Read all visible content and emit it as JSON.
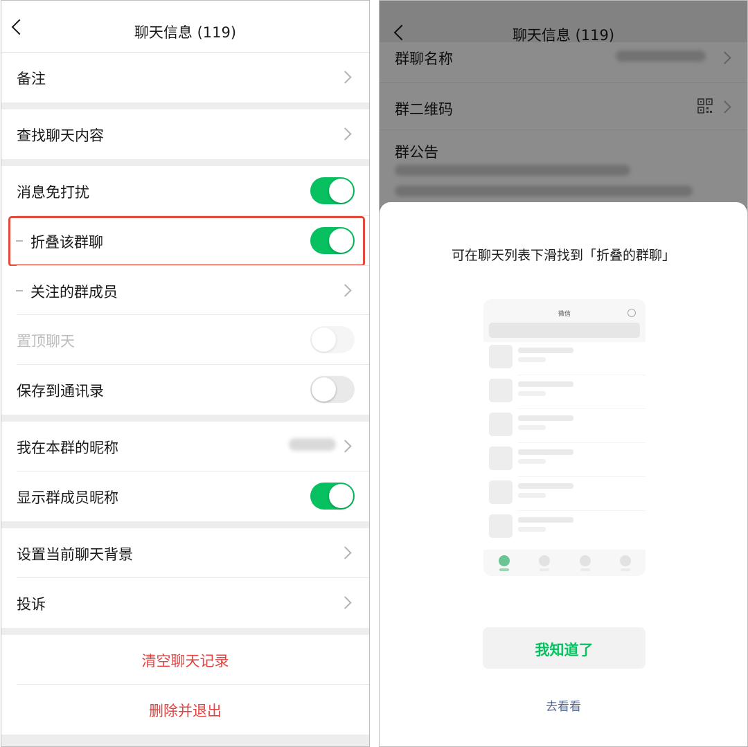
{
  "left": {
    "nav": {
      "title": "聊天信息 (119)"
    },
    "rows": {
      "remark": "备注",
      "search_chat": "查找聊天内容",
      "mute": "消息免打扰",
      "fold_group": "折叠该群聊",
      "follow_members": "关注的群成员",
      "sticky": "置顶聊天",
      "save_contacts": "保存到通讯录",
      "my_nickname": "我在本群的昵称",
      "show_nicknames": "显示群成员昵称",
      "set_background": "设置当前聊天背景",
      "complain": "投诉"
    },
    "toggles": {
      "mute": true,
      "fold_group": true,
      "sticky": false,
      "save_contacts": false,
      "show_nicknames": true
    },
    "actions": {
      "clear_history": "清空聊天记录",
      "delete_exit": "删除并退出"
    }
  },
  "right": {
    "nav": {
      "title": "聊天信息 (119)"
    },
    "background_rows": {
      "group_name": "群聊名称",
      "group_qr": "群二维码",
      "group_notice": "群公告"
    },
    "sheet": {
      "heading": "可在聊天列表下滑找到「折叠的群聊」",
      "mock_title": "微信",
      "confirm_button": "我知道了",
      "go_see_link": "去看看"
    }
  },
  "colors": {
    "accent_green": "#07c160",
    "danger_red": "#e64340",
    "highlight_border": "#e24a3b",
    "link_blue": "#576b95"
  },
  "icons": [
    "back-chevron-icon",
    "chevron-right-icon",
    "qr-code-icon",
    "toggle-switch"
  ]
}
